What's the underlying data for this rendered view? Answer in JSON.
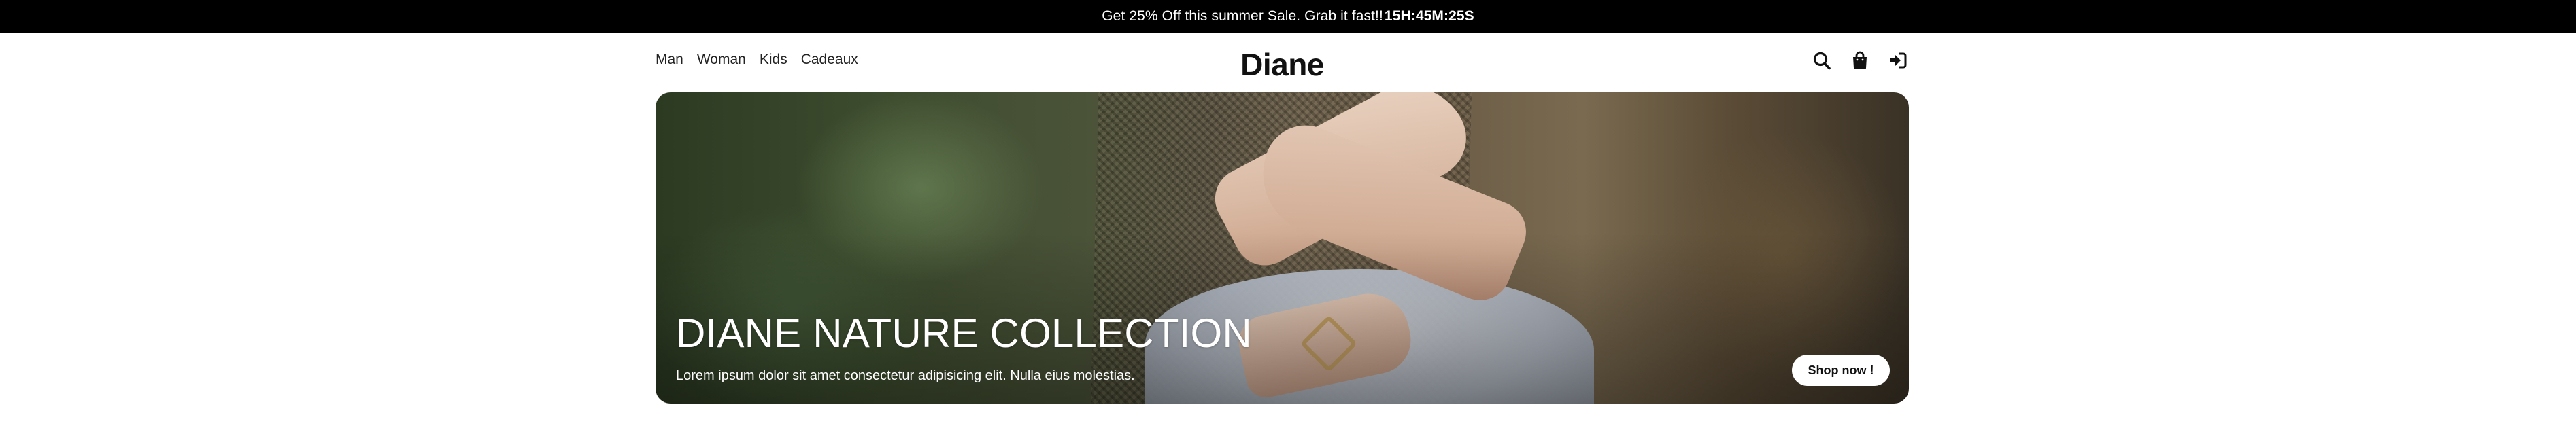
{
  "promo": {
    "text": "Get 25% Off this summer Sale. Grab it fast!!",
    "countdown": "15H:45M:25S"
  },
  "nav": {
    "items": [
      "Man",
      "Woman",
      "Kids",
      "Cadeaux"
    ]
  },
  "brand": {
    "logo": "Diane"
  },
  "header_icons": [
    "search-icon",
    "shopping-bag-icon",
    "sign-in-icon"
  ],
  "hero": {
    "title": "DIANE NATURE COLLECTION",
    "subtitle": "Lorem ipsum dolor sit amet consectetur adipisicing elit. Nulla eius molestias.",
    "cta_label": "Shop now !"
  },
  "colors": {
    "promo_bg": "#000000",
    "promo_text": "#ffffff",
    "button_bg": "#ffffff",
    "hero_text": "#ffffff"
  }
}
